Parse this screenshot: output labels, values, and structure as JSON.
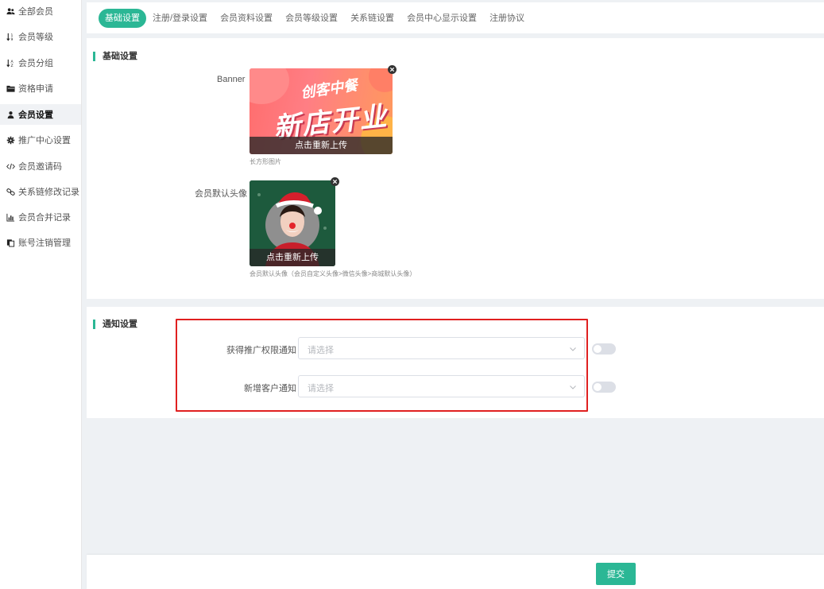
{
  "sidebar": {
    "items": [
      {
        "label": "全部会员",
        "icon": "users-icon"
      },
      {
        "label": "会员等级",
        "icon": "sort-numeric-icon"
      },
      {
        "label": "会员分组",
        "icon": "sort-alpha-icon"
      },
      {
        "label": "资格申请",
        "icon": "folder-open-icon"
      },
      {
        "label": "会员设置",
        "icon": "user-icon",
        "active": true
      },
      {
        "label": "推广中心设置",
        "icon": "gear-icon"
      },
      {
        "label": "会员邀请码",
        "icon": "code-icon"
      },
      {
        "label": "关系链修改记录",
        "icon": "link-icon"
      },
      {
        "label": "会员合并记录",
        "icon": "bar-chart-icon"
      },
      {
        "label": "账号注销管理",
        "icon": "copy-icon"
      }
    ]
  },
  "tabs": [
    {
      "label": "基础设置",
      "active": true
    },
    {
      "label": "注册/登录设置"
    },
    {
      "label": "会员资料设置"
    },
    {
      "label": "会员等级设置"
    },
    {
      "label": "关系链设置"
    },
    {
      "label": "会员中心显示设置"
    },
    {
      "label": "注册协议"
    }
  ],
  "basic": {
    "title": "基础设置",
    "banner_label": "Banner",
    "banner_reupload": "点击重新上传",
    "banner_hint": "长方形图片",
    "banner_art_line1": "创客中餐",
    "banner_art_line2": "新店开业",
    "avatar_label": "会员默认头像",
    "avatar_reupload": "点击重新上传",
    "avatar_hint": "会员默认头像（会员自定义头像>微信头像>商城默认头像）"
  },
  "notify": {
    "title": "通知设置",
    "fields": [
      {
        "label": "获得推广权限通知",
        "placeholder": "请选择",
        "enabled": false
      },
      {
        "label": "新增客户通知",
        "placeholder": "请选择",
        "enabled": false
      }
    ]
  },
  "footer": {
    "submit_label": "提交"
  },
  "colors": {
    "accent": "#2bb795",
    "highlight": "#e02020"
  }
}
